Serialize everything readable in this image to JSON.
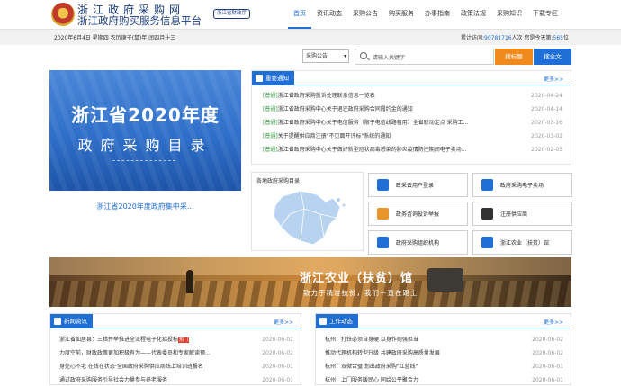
{
  "site": {
    "title_line1": "浙江政府采购网",
    "title_line2": "浙江政府购买服务信息平台",
    "badge": "浙江省财政厅"
  },
  "nav": {
    "items": [
      {
        "label": "首页",
        "active": true
      },
      {
        "label": "资讯动态",
        "active": false
      },
      {
        "label": "采购公告",
        "active": false
      },
      {
        "label": "购买服务",
        "active": false
      },
      {
        "label": "办事指南",
        "active": false
      },
      {
        "label": "政策法规",
        "active": false
      },
      {
        "label": "采购知识",
        "active": false
      },
      {
        "label": "下载专区",
        "active": false
      }
    ]
  },
  "topbar": {
    "date": "2020年6月4日 星期四 农历庚子(鼠)年 闰四月十三",
    "visits_prefix": "累计访问:",
    "visits_count": "90781716",
    "visits_mid": "人次 您是今天第:",
    "today_count": "565",
    "visits_suffix": "位"
  },
  "search": {
    "select_value": "采购公告",
    "placeholder": "请输入关键字",
    "btn_title": "搜标题",
    "btn_full": "搜全文"
  },
  "banner": {
    "title": "浙江省2020年度",
    "subtitle": "政府采购目录",
    "caption": "浙江省2020年度政府集中采..."
  },
  "notices": {
    "header": "重要通知",
    "more": "更多>>",
    "items": [
      {
        "tag": "[普通]",
        "text": "浙江省政府采购投诉处理联系信息一览表",
        "date": "2020-04-24"
      },
      {
        "tag": "[普通]",
        "text": "浙江省政府采购中心关于退还政府采购合同履约金的通知",
        "date": "2020-04-14"
      },
      {
        "tag": "[普通]",
        "text": "浙江省政府采购中心关于电信服务（限于电信线路租用）全省联动定点 采购工...",
        "date": "2020-03-16"
      },
      {
        "tag": "[普通]",
        "text": "关于提醒供应商注册\"不见面开评标\"系统的通知",
        "date": "2020-03-02"
      },
      {
        "tag": "[普通]",
        "text": "浙江省政府采购中心关于做好新型冠状病毒感染的肺炎疫情防控期间电子卖场...",
        "date": "2020-02-03"
      }
    ]
  },
  "map": {
    "title": "各地政府采购目录"
  },
  "tiles": [
    {
      "label": "政采云用户登录"
    },
    {
      "label": "政府采购电子卖场"
    },
    {
      "label": "政务咨询投诉举报"
    },
    {
      "label": "注册供应商"
    },
    {
      "label": "政府采购组织机构"
    },
    {
      "label": "浙江农业（扶贫）馆"
    }
  ],
  "farm": {
    "title": "浙江农业（扶贫）馆",
    "slogan": "致力于精准扶贫，我们一直在路上"
  },
  "news": {
    "header": "新闻资讯",
    "more": "更多>>",
    "items": [
      {
        "text": "浙江省仙居县：三措并举推进全流程电子化招投标",
        "hot": "热门",
        "date": "2020-06-02"
      },
      {
        "text": "力度空前，财政政策更加积极有为——代表委员和专家解读预...",
        "date": "2020-06-02"
      },
      {
        "text": "身处心不宅 在线在状态·全国政府采购供应商线上培训班报名",
        "date": "2020-06-01"
      },
      {
        "text": "通过政府采购服务引导社会力量参与养老服务",
        "date": "2020-06-01"
      }
    ]
  },
  "work": {
    "header": "工作动态",
    "more": "更多>>",
    "items": [
      {
        "text": "杭州：打铁必须自身硬 以身作则强担当",
        "date": "2020-06-02"
      },
      {
        "text": "推动代理机构转型升级 共建政府采购高质量发展",
        "date": "2020-06-02"
      },
      {
        "text": "杭州：双微合璧 划出政府采购\"红蓝线\"",
        "date": "2020-06-01"
      },
      {
        "text": "杭州：上门服务暖民心 同绘公平聚合力",
        "date": "2020-06-01"
      }
    ]
  },
  "colors": {
    "primary": "#1f6fd6",
    "orange": "#f08a1c",
    "tag_green": "#2e9a3c"
  }
}
